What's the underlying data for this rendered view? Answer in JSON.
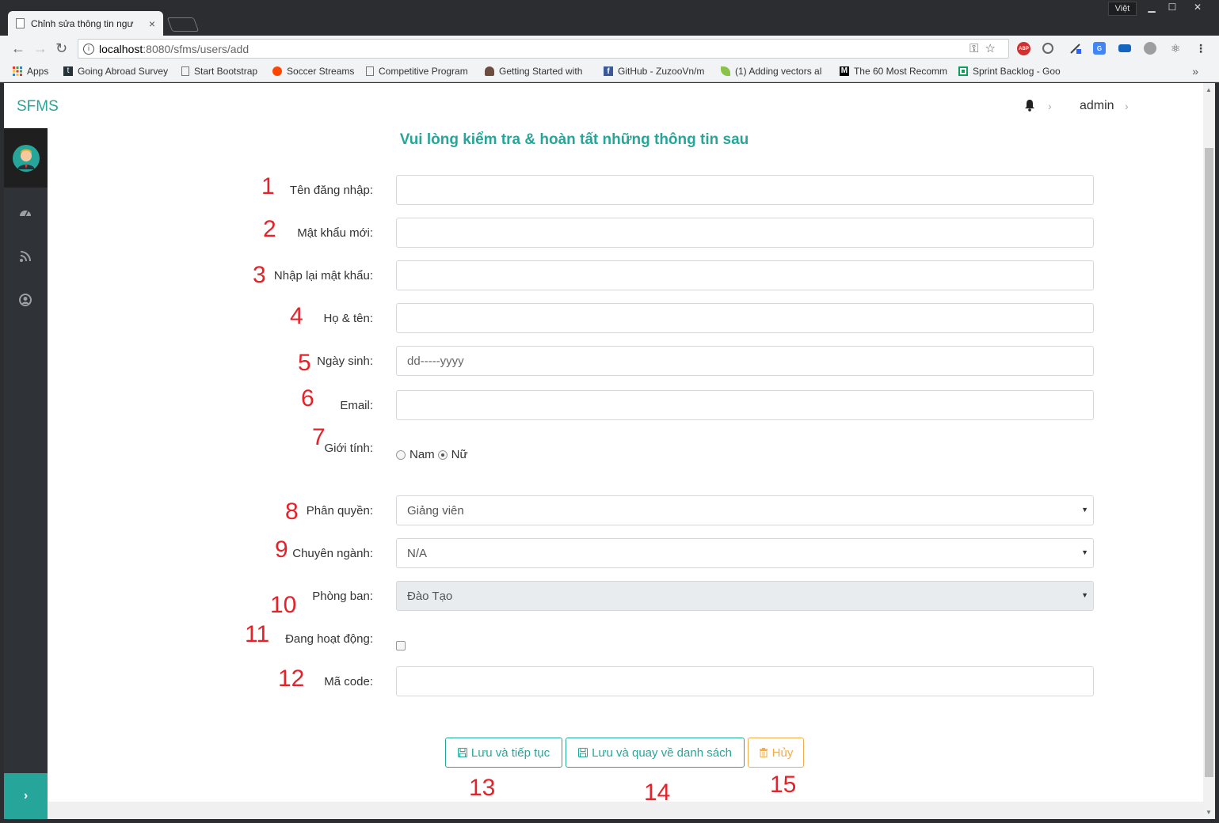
{
  "browser": {
    "tab_title": "Chỉnh sửa thông tin ngư",
    "tab_close": "×",
    "language_badge": "Việt",
    "url_host": "localhost",
    "url_path": ":8080/sfms/users/add",
    "bookmarks": [
      {
        "label": "Apps",
        "icon": "apps-grid-icon"
      },
      {
        "label": "Going Abroad Survey",
        "icon": "typeform-icon"
      },
      {
        "label": "Start Bootstrap",
        "icon": "page-icon"
      },
      {
        "label": "Soccer Streams",
        "icon": "reddit-icon"
      },
      {
        "label": "Competitive Program",
        "icon": "page-icon"
      },
      {
        "label": "Getting Started with",
        "icon": "mascot-icon"
      },
      {
        "label": "GitHub - ZuzooVn/m",
        "icon": "facebook-icon"
      },
      {
        "label": "(1) Adding vectors al",
        "icon": "leaf-icon"
      },
      {
        "label": "The 60 Most Recomm",
        "icon": "medium-icon"
      },
      {
        "label": "Sprint Backlog - Goo",
        "icon": "sheets-icon"
      }
    ],
    "bookmarks_more": "»",
    "extensions": {
      "abp": "ABP"
    }
  },
  "header": {
    "brand": "SFMS",
    "user": "admin"
  },
  "form": {
    "heading": "Vui lòng kiểm tra & hoàn tất những thông tin sau",
    "username_label": "Tên đăng nhập:",
    "username_value": "",
    "password_label": "Mật khẩu mới:",
    "password_value": "",
    "confirm_label": "Nhập lại mật khẩu:",
    "confirm_value": "",
    "fullname_label": "Họ & tên:",
    "fullname_value": "",
    "dob_label": "Ngày sinh:",
    "dob_placeholder": "dd-----yyyy",
    "email_label": "Email:",
    "email_value": "",
    "gender_label": "Giới tính:",
    "gender_male": "Nam",
    "gender_female": "Nữ",
    "gender_selected": "Nữ",
    "role_label": "Phân quyền:",
    "role_value": "Giảng viên",
    "major_label": "Chuyên ngành:",
    "major_value": "N/A",
    "department_label": "Phòng ban:",
    "department_value": "Đào Tạo",
    "active_label": "Đang hoạt động:",
    "active_checked": false,
    "code_label": "Mã code:",
    "code_value": ""
  },
  "buttons": {
    "save_continue": "Lưu và tiếp tục",
    "save_return": "Lưu và quay về danh sách",
    "cancel": "Hủy"
  },
  "annotations": [
    "1",
    "2",
    "3",
    "4",
    "5",
    "6",
    "7",
    "8",
    "9",
    "10",
    "11",
    "12",
    "13",
    "14",
    "15"
  ],
  "colors": {
    "accent": "#26a69a",
    "warning": "#f0ad4e",
    "annotation": "#e5222a",
    "sidebar": "#2f3237"
  }
}
